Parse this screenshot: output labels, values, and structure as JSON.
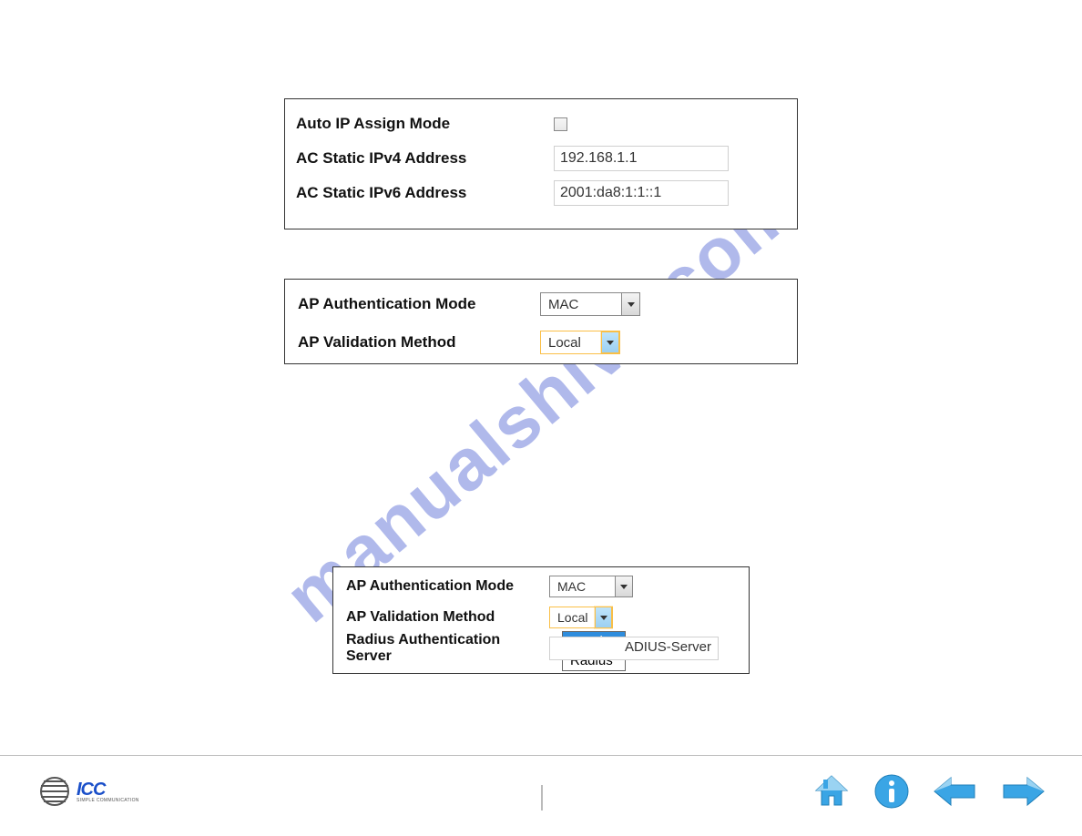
{
  "watermark": "manualshive.com",
  "panel1": {
    "auto_ip_label": "Auto IP Assign Mode",
    "auto_ip_checked": false,
    "ipv4_label": "AC Static IPv4 Address",
    "ipv4_value": "192.168.1.1",
    "ipv6_label": "AC Static IPv6 Address",
    "ipv6_value": "2001:da8:1:1::1"
  },
  "panel2": {
    "auth_mode_label": "AP Authentication Mode",
    "auth_mode_value": "MAC",
    "validation_label": "AP Validation Method",
    "validation_value": "Local"
  },
  "panel3": {
    "auth_mode_label": "AP Authentication Mode",
    "auth_mode_value": "MAC",
    "validation_label": "AP Validation Method",
    "validation_value": "Local",
    "validation_options": [
      "Local",
      "Radius"
    ],
    "radius_label": "Radius Authentication Server",
    "radius_value_visible": "ADIUS-Server"
  },
  "footer": {
    "brand_name": "ICC",
    "brand_subtitle": "SIMPLE COMMUNICATION"
  }
}
